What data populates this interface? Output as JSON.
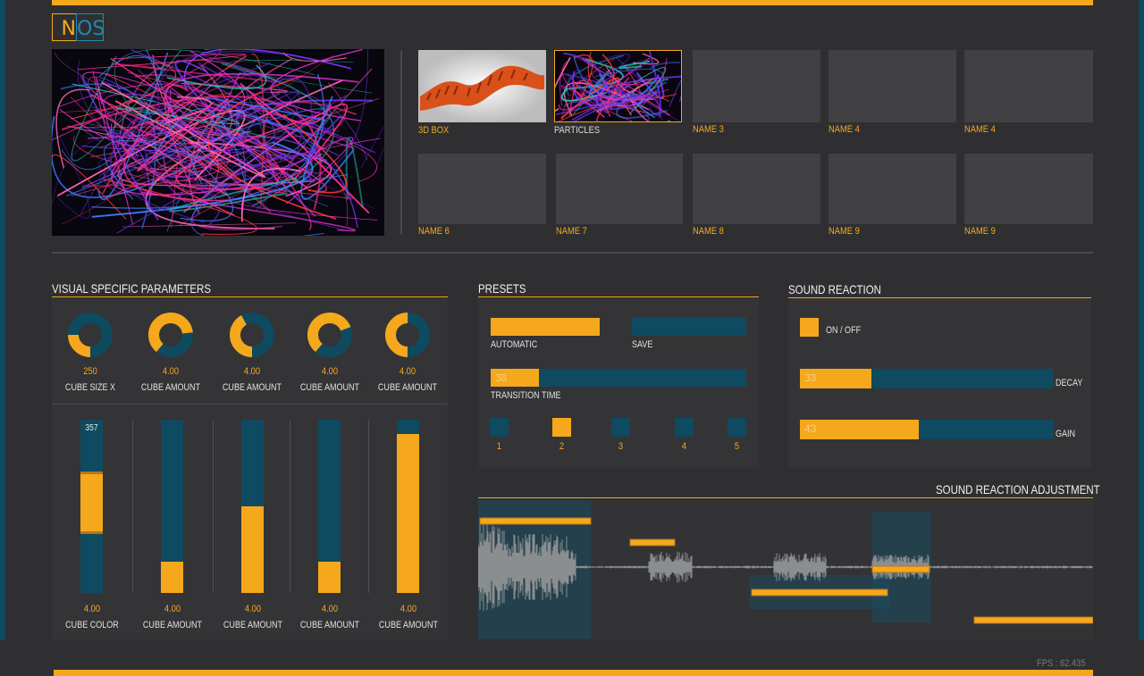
{
  "logo": {
    "left": "N",
    "right": "OS"
  },
  "visuals_row1": [
    {
      "label": "3D BOX",
      "selected": false
    },
    {
      "label": "PARTICLES",
      "selected": true
    },
    {
      "label": "NAME 3",
      "selected": false
    },
    {
      "label": "NAME 4",
      "selected": false
    },
    {
      "label": "NAME 4",
      "selected": false
    }
  ],
  "visuals_row2": [
    {
      "label": "NAME 6"
    },
    {
      "label": "NAME 7"
    },
    {
      "label": "NAME 8"
    },
    {
      "label": "NAME 9"
    },
    {
      "label": "NAME 9"
    }
  ],
  "visual_params": {
    "title": "VISUAL SPECIFIC PARAMETERS",
    "knobs": [
      {
        "value": "250",
        "label": "CUBE SIZE X",
        "level": 0.25
      },
      {
        "value": "4.00",
        "label": "CUBE AMOUNT",
        "level": 0.62
      },
      {
        "value": "4.00",
        "label": "CUBE AMOUNT",
        "level": 0.42
      },
      {
        "value": "4.00",
        "label": "CUBE AMOUNT",
        "level": 0.58
      },
      {
        "value": "4.00",
        "label": "CUBE AMOUNT",
        "level": 0.5
      }
    ],
    "sliders": [
      {
        "value": "4.00",
        "label": "CUBE COLOR",
        "top_label": "357",
        "range": [
          0.3,
          0.66
        ]
      },
      {
        "value": "4.00",
        "label": "CUBE AMOUNT",
        "level": 0.18
      },
      {
        "value": "4.00",
        "label": "CUBE AMOUNT",
        "level": 0.5
      },
      {
        "value": "4.00",
        "label": "CUBE AMOUNT",
        "level": 0.18
      },
      {
        "value": "4.00",
        "label": "CUBE AMOUNT",
        "level": 0.92
      }
    ]
  },
  "presets": {
    "title": "PRESETS",
    "automatic_label": "AUTOMATIC",
    "save_label": "SAVE",
    "transition_value": "38",
    "transition_label": "TRANSITION TIME",
    "transition_level": 0.19,
    "slots": [
      "1",
      "2",
      "3",
      "4",
      "5"
    ],
    "active_slot": 1
  },
  "sound": {
    "title": "SOUND REACTION",
    "onoff_label": "ON / OFF",
    "decay_value": "33",
    "decay_label": "DECAY",
    "decay_level": 0.28,
    "gain_value": "43",
    "gain_label": "GAIN",
    "gain_level": 0.47
  },
  "adjust": {
    "title": "SOUND REACTION ADJUSTMENT"
  },
  "fps": "FPS : 62.435",
  "colors": {
    "accent": "#f5a81c",
    "track": "#0e4a60",
    "bg": "#2f2f31"
  }
}
